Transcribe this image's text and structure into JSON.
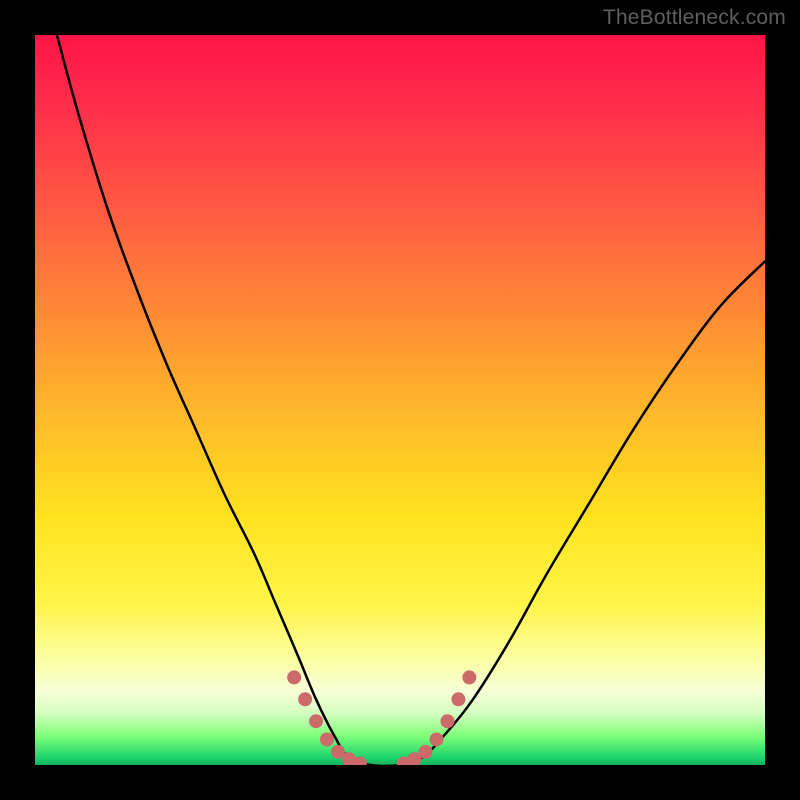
{
  "watermark": {
    "text": "TheBottleneck.com"
  },
  "gradient": {
    "top": "#ff1447",
    "mid_upper": "#ff8a35",
    "mid": "#ffe31e",
    "mid_lower": "#fbffa8",
    "bottom": "#12b05c"
  },
  "chart_data": {
    "type": "line",
    "title": "",
    "xlabel": "",
    "ylabel": "",
    "xlim": [
      0,
      100
    ],
    "ylim": [
      0,
      100
    ],
    "grid": false,
    "legend": false,
    "annotations": [],
    "series": [
      {
        "name": "curve",
        "stroke": "#000000",
        "stroke_width": 2.5,
        "x": [
          3,
          6,
          10,
          14,
          18,
          22,
          26,
          30,
          33,
          36,
          38.5,
          41,
          43,
          46,
          50,
          53,
          56,
          60,
          65,
          70,
          76,
          82,
          88,
          94,
          100
        ],
        "y": [
          100,
          89,
          76,
          65,
          55,
          46,
          37,
          29,
          22,
          15,
          9,
          4,
          1,
          0,
          0,
          1,
          4,
          9,
          17,
          26,
          36,
          46,
          55,
          63,
          69
        ]
      },
      {
        "name": "marker-dots",
        "stroke": "#cc6a6a",
        "marker_radius": 7,
        "x": [
          35.5,
          37.0,
          38.5,
          40.0,
          41.5,
          43.0,
          44.5,
          50.5,
          52.0,
          53.5,
          55.0,
          56.5,
          58.0,
          59.5
        ],
        "y": [
          12.0,
          9.0,
          6.0,
          3.5,
          1.8,
          0.8,
          0.2,
          0.2,
          0.8,
          1.8,
          3.5,
          6.0,
          9.0,
          12.0
        ]
      }
    ]
  }
}
